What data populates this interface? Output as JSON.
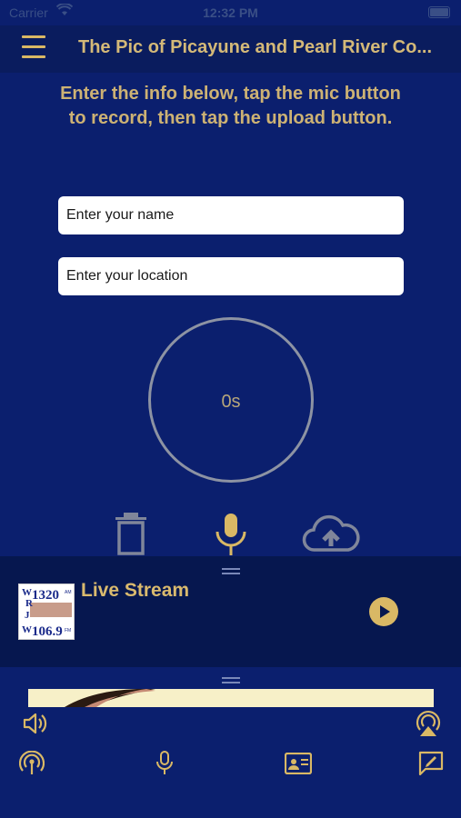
{
  "status_bar": {
    "carrier": "Carrier",
    "time": "12:32 PM"
  },
  "header": {
    "title": "The Pic of Picayune and Pearl River Co...",
    "menu_icon": "hamburger-menu-icon"
  },
  "main": {
    "instructions": "Enter the info below, tap the mic button to record, then tap the upload button.",
    "name_placeholder": "Enter your name",
    "location_placeholder": "Enter your location",
    "timer": "0s",
    "controls": {
      "delete_icon": "trash-icon",
      "record_icon": "microphone-icon",
      "upload_icon": "cloud-upload-icon"
    }
  },
  "player": {
    "title": "Live Stream",
    "logo": {
      "am": "1320",
      "am_unit": "AM",
      "fm": "106.9",
      "fm_unit": "FM",
      "letters": [
        "W",
        "R",
        "J",
        "W"
      ]
    }
  },
  "bottom_bar": {
    "icons": [
      "volume-icon",
      "airplay-icon",
      "broadcast-icon",
      "microphone-icon",
      "contact-card-icon",
      "compose-message-icon"
    ]
  },
  "colors": {
    "background": "#0b1f6e",
    "gold": "#d9b865",
    "player_bg": "#06174f"
  }
}
